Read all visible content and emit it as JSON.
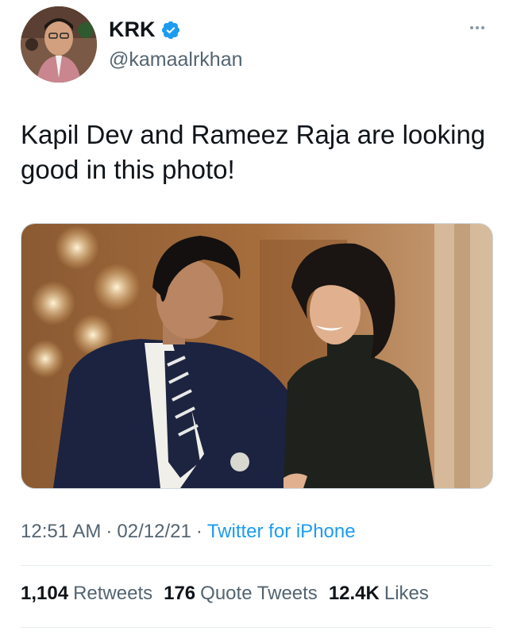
{
  "author": {
    "display_name": "KRK",
    "handle": "@kamaalrkhan",
    "verified_icon": "verified-badge-icon",
    "badge_color": "#1d9bf0"
  },
  "more_icon": "more-options-icon",
  "tweet": {
    "text": "Kapil Dev and Rameez Raja are looking good in this photo!"
  },
  "meta": {
    "time": "12:51 AM",
    "separator": "·",
    "date": "02/12/21",
    "source": "Twitter for iPhone"
  },
  "stats": {
    "retweets_count": "1,104",
    "retweets_label": "Retweets",
    "quotes_count": "176",
    "quotes_label": "Quote Tweets",
    "likes_count": "12.4K",
    "likes_label": "Likes"
  },
  "colors": {
    "link": "#1d9bf0",
    "secondary_text": "#536471",
    "primary_text": "#0f1419"
  }
}
